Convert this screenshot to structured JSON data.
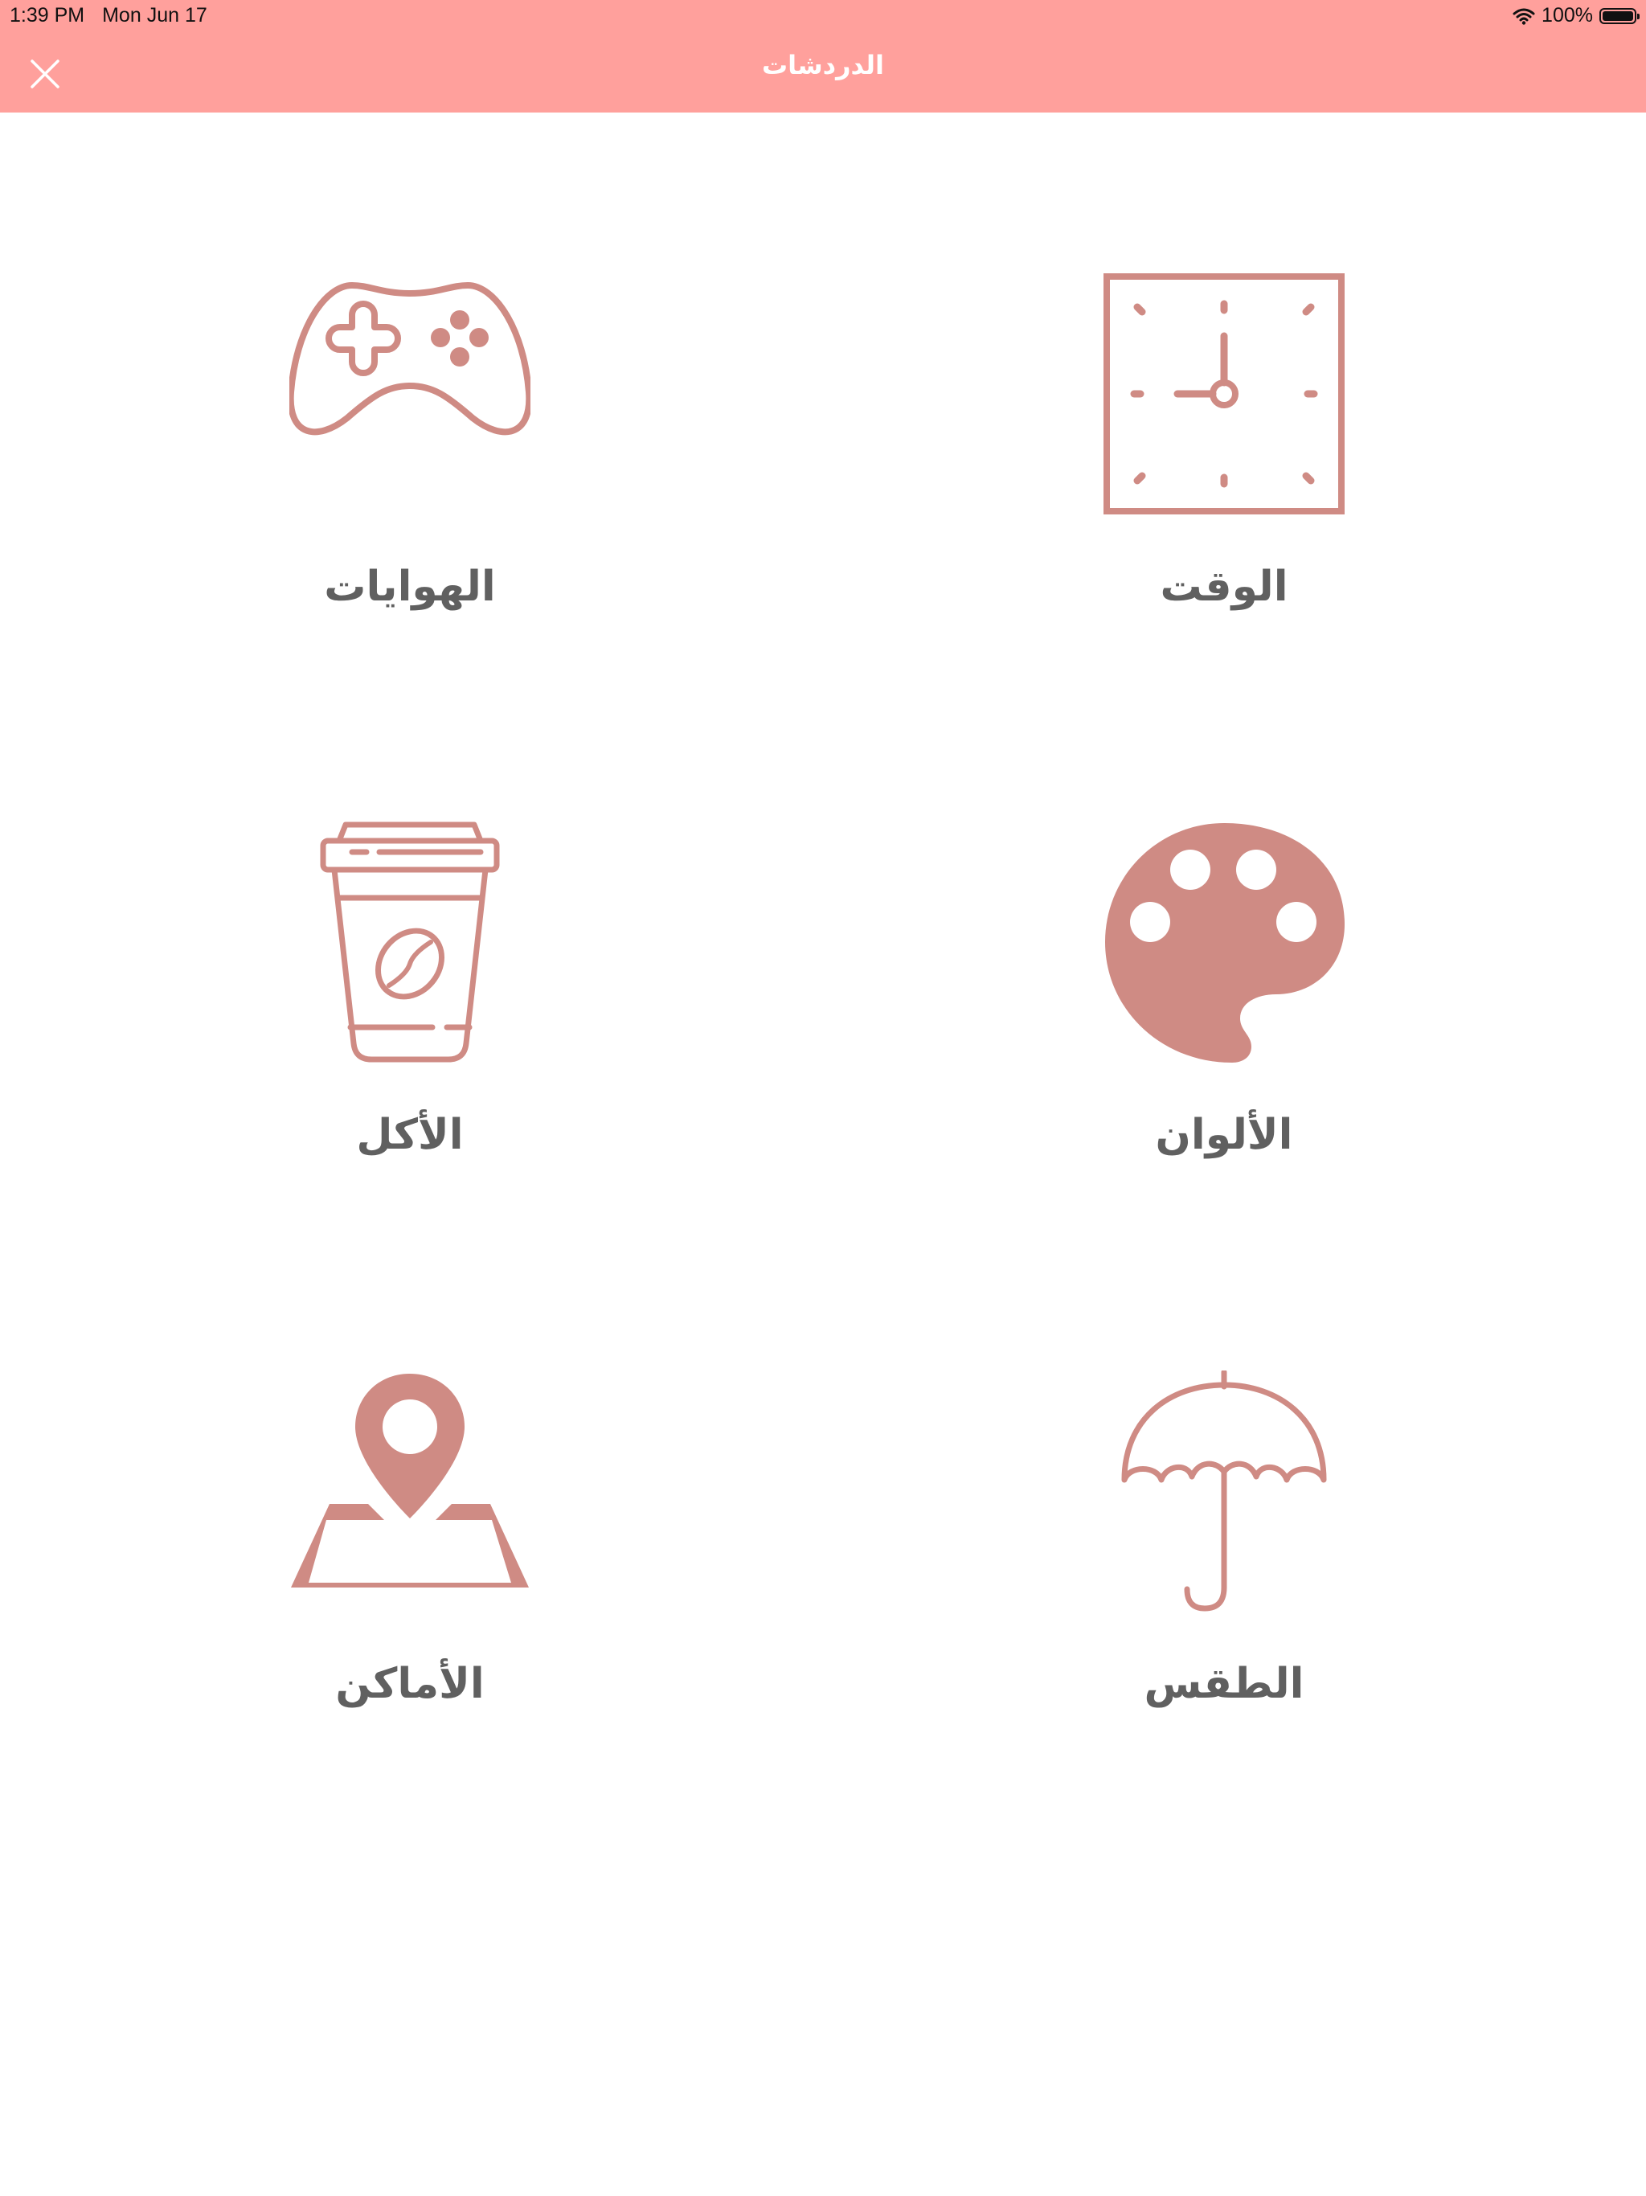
{
  "status_bar": {
    "time": "1:39 PM",
    "date": "Mon Jun 17",
    "battery": "100%",
    "wifi_icon": "wifi-icon",
    "battery_icon": "battery-icon"
  },
  "header": {
    "title": "الدردشات",
    "close_icon": "close-icon",
    "color": "#ffa09c"
  },
  "accent_color": "#cf8b84",
  "categories": [
    {
      "label": "الهوايات",
      "icon": "gamepad-icon"
    },
    {
      "label": "الوقت",
      "icon": "clock-icon"
    },
    {
      "label": "الأكل",
      "icon": "coffee-cup-icon"
    },
    {
      "label": "الألوان",
      "icon": "palette-icon"
    },
    {
      "label": "الأماكن",
      "icon": "map-pin-icon"
    },
    {
      "label": "الطقس",
      "icon": "umbrella-icon"
    }
  ]
}
